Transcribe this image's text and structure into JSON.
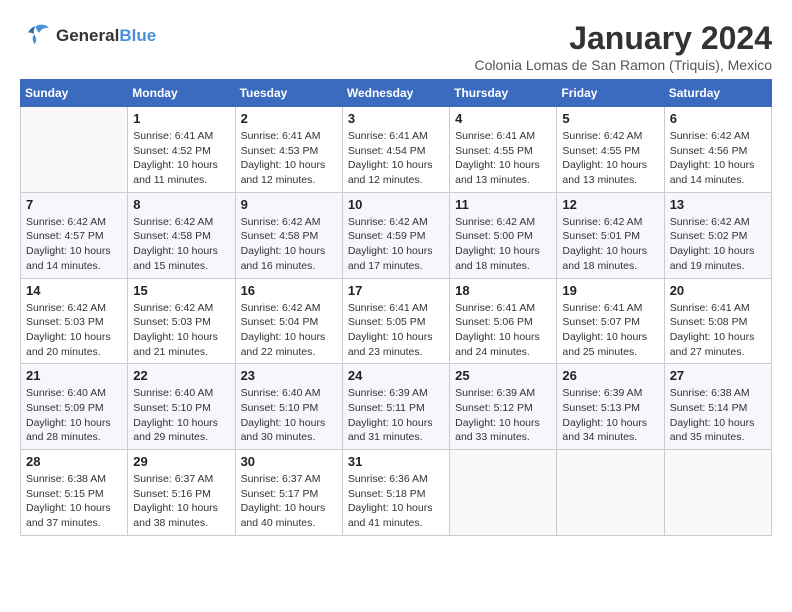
{
  "header": {
    "logo_line1": "General",
    "logo_line2": "Blue",
    "month": "January 2024",
    "location": "Colonia Lomas de San Ramon (Triquis), Mexico"
  },
  "columns": [
    "Sunday",
    "Monday",
    "Tuesday",
    "Wednesday",
    "Thursday",
    "Friday",
    "Saturday"
  ],
  "weeks": [
    [
      {
        "day": "",
        "info": ""
      },
      {
        "day": "1",
        "info": "Sunrise: 6:41 AM\nSunset: 4:52 PM\nDaylight: 10 hours\nand 11 minutes."
      },
      {
        "day": "2",
        "info": "Sunrise: 6:41 AM\nSunset: 4:53 PM\nDaylight: 10 hours\nand 12 minutes."
      },
      {
        "day": "3",
        "info": "Sunrise: 6:41 AM\nSunset: 4:54 PM\nDaylight: 10 hours\nand 12 minutes."
      },
      {
        "day": "4",
        "info": "Sunrise: 6:41 AM\nSunset: 4:55 PM\nDaylight: 10 hours\nand 13 minutes."
      },
      {
        "day": "5",
        "info": "Sunrise: 6:42 AM\nSunset: 4:55 PM\nDaylight: 10 hours\nand 13 minutes."
      },
      {
        "day": "6",
        "info": "Sunrise: 6:42 AM\nSunset: 4:56 PM\nDaylight: 10 hours\nand 14 minutes."
      }
    ],
    [
      {
        "day": "7",
        "info": "Sunrise: 6:42 AM\nSunset: 4:57 PM\nDaylight: 10 hours\nand 14 minutes."
      },
      {
        "day": "8",
        "info": "Sunrise: 6:42 AM\nSunset: 4:58 PM\nDaylight: 10 hours\nand 15 minutes."
      },
      {
        "day": "9",
        "info": "Sunrise: 6:42 AM\nSunset: 4:58 PM\nDaylight: 10 hours\nand 16 minutes."
      },
      {
        "day": "10",
        "info": "Sunrise: 6:42 AM\nSunset: 4:59 PM\nDaylight: 10 hours\nand 17 minutes."
      },
      {
        "day": "11",
        "info": "Sunrise: 6:42 AM\nSunset: 5:00 PM\nDaylight: 10 hours\nand 18 minutes."
      },
      {
        "day": "12",
        "info": "Sunrise: 6:42 AM\nSunset: 5:01 PM\nDaylight: 10 hours\nand 18 minutes."
      },
      {
        "day": "13",
        "info": "Sunrise: 6:42 AM\nSunset: 5:02 PM\nDaylight: 10 hours\nand 19 minutes."
      }
    ],
    [
      {
        "day": "14",
        "info": "Sunrise: 6:42 AM\nSunset: 5:03 PM\nDaylight: 10 hours\nand 20 minutes."
      },
      {
        "day": "15",
        "info": "Sunrise: 6:42 AM\nSunset: 5:03 PM\nDaylight: 10 hours\nand 21 minutes."
      },
      {
        "day": "16",
        "info": "Sunrise: 6:42 AM\nSunset: 5:04 PM\nDaylight: 10 hours\nand 22 minutes."
      },
      {
        "day": "17",
        "info": "Sunrise: 6:41 AM\nSunset: 5:05 PM\nDaylight: 10 hours\nand 23 minutes."
      },
      {
        "day": "18",
        "info": "Sunrise: 6:41 AM\nSunset: 5:06 PM\nDaylight: 10 hours\nand 24 minutes."
      },
      {
        "day": "19",
        "info": "Sunrise: 6:41 AM\nSunset: 5:07 PM\nDaylight: 10 hours\nand 25 minutes."
      },
      {
        "day": "20",
        "info": "Sunrise: 6:41 AM\nSunset: 5:08 PM\nDaylight: 10 hours\nand 27 minutes."
      }
    ],
    [
      {
        "day": "21",
        "info": "Sunrise: 6:40 AM\nSunset: 5:09 PM\nDaylight: 10 hours\nand 28 minutes."
      },
      {
        "day": "22",
        "info": "Sunrise: 6:40 AM\nSunset: 5:10 PM\nDaylight: 10 hours\nand 29 minutes."
      },
      {
        "day": "23",
        "info": "Sunrise: 6:40 AM\nSunset: 5:10 PM\nDaylight: 10 hours\nand 30 minutes."
      },
      {
        "day": "24",
        "info": "Sunrise: 6:39 AM\nSunset: 5:11 PM\nDaylight: 10 hours\nand 31 minutes."
      },
      {
        "day": "25",
        "info": "Sunrise: 6:39 AM\nSunset: 5:12 PM\nDaylight: 10 hours\nand 33 minutes."
      },
      {
        "day": "26",
        "info": "Sunrise: 6:39 AM\nSunset: 5:13 PM\nDaylight: 10 hours\nand 34 minutes."
      },
      {
        "day": "27",
        "info": "Sunrise: 6:38 AM\nSunset: 5:14 PM\nDaylight: 10 hours\nand 35 minutes."
      }
    ],
    [
      {
        "day": "28",
        "info": "Sunrise: 6:38 AM\nSunset: 5:15 PM\nDaylight: 10 hours\nand 37 minutes."
      },
      {
        "day": "29",
        "info": "Sunrise: 6:37 AM\nSunset: 5:16 PM\nDaylight: 10 hours\nand 38 minutes."
      },
      {
        "day": "30",
        "info": "Sunrise: 6:37 AM\nSunset: 5:17 PM\nDaylight: 10 hours\nand 40 minutes."
      },
      {
        "day": "31",
        "info": "Sunrise: 6:36 AM\nSunset: 5:18 PM\nDaylight: 10 hours\nand 41 minutes."
      },
      {
        "day": "",
        "info": ""
      },
      {
        "day": "",
        "info": ""
      },
      {
        "day": "",
        "info": ""
      }
    ]
  ]
}
